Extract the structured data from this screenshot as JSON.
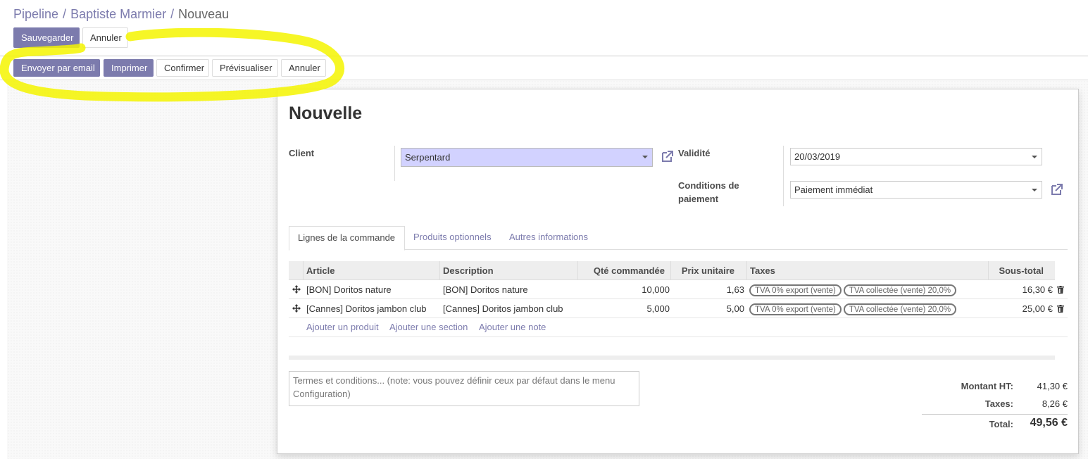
{
  "breadcrumb": {
    "items": [
      "Pipeline",
      "Baptiste Marmier"
    ],
    "current": "Nouveau",
    "separator": "/"
  },
  "control_buttons": {
    "save": "Sauvegarder",
    "cancel": "Annuler"
  },
  "status_buttons": {
    "send_email": "Envoyer par email",
    "print": "Imprimer",
    "confirm": "Confirmer",
    "preview": "Prévisualiser",
    "cancel": "Annuler"
  },
  "form": {
    "title": "Nouvelle",
    "client_label": "Client",
    "client_value": "Serpentard",
    "validity_label": "Validité",
    "validity_value": "20/03/2019",
    "payment_label_line1": "Conditions de",
    "payment_label_line2": "paiement",
    "payment_value": "Paiement immédiat"
  },
  "tabs": [
    "Lignes de la commande",
    "Produits optionnels",
    "Autres informations"
  ],
  "table": {
    "headers": [
      "Article",
      "Description",
      "Qté commandée",
      "Prix unitaire",
      "Taxes",
      "Sous-total"
    ],
    "rows": [
      {
        "article": "[BON] Doritos nature",
        "description": "[BON] Doritos nature",
        "qty": "10,000",
        "price": "1,63",
        "taxes": [
          "TVA 0% export (vente)",
          "TVA collectée (vente) 20,0%"
        ],
        "subtotal": "16,30 €"
      },
      {
        "article": "[Cannes] Doritos jambon club",
        "description": "[Cannes] Doritos jambon club",
        "qty": "5,000",
        "price": "5,00",
        "taxes": [
          "TVA 0% export (vente)",
          "TVA collectée (vente) 20,0%"
        ],
        "subtotal": "25,00 €"
      }
    ],
    "add_product": "Ajouter un produit",
    "add_section": "Ajouter une section",
    "add_note": "Ajouter une note"
  },
  "terms_placeholder": "Termes et conditions... (note: vous pouvez définir ceux par défaut dans le menu Configuration)",
  "totals": {
    "untaxed_label": "Montant HT:",
    "untaxed_value": "41,30 €",
    "taxes_label": "Taxes:",
    "taxes_value": "8,26 €",
    "total_label": "Total:",
    "total_value": "49,56 €"
  },
  "colors": {
    "primary": "#7c7bad",
    "highlight": "#f5f500",
    "client_field": "#d2d2ff"
  },
  "icons": [
    "external-link-icon",
    "drag-handle-icon",
    "trash-icon",
    "caret-down-icon"
  ]
}
